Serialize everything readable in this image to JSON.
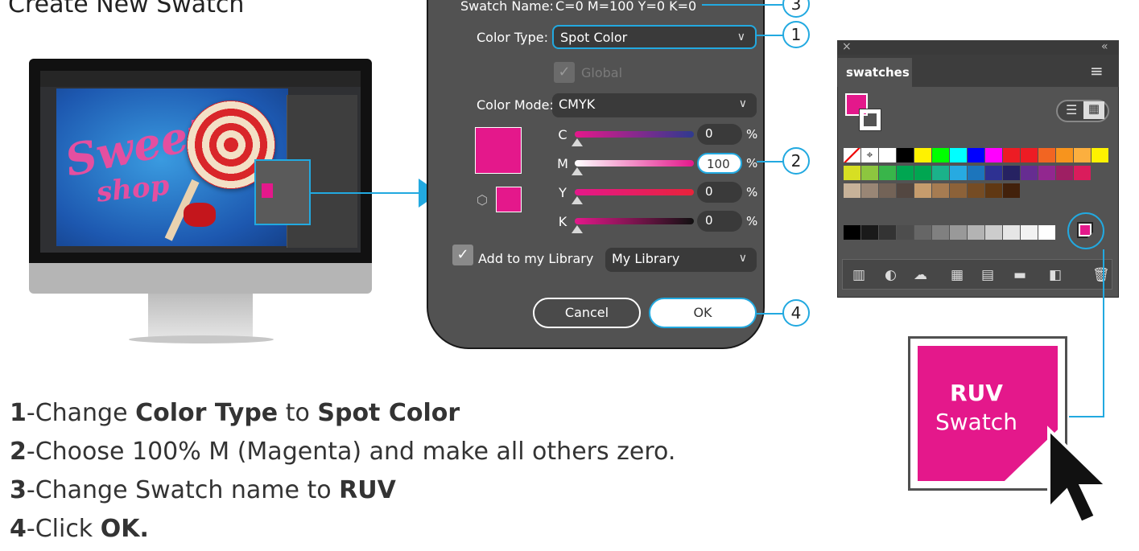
{
  "title": "Create New Swatch",
  "steps": [
    {
      "num": "1",
      "parts": [
        "-Change ",
        "Color Type",
        " to ",
        "Spot Color",
        ""
      ]
    },
    {
      "num": "2",
      "text": "-Choose 100% M (Magenta) and make all others zero."
    },
    {
      "num": "3",
      "text": "-Change Swatch name to ",
      "bold": "RUV"
    },
    {
      "num": "4",
      "text": "-Click ",
      "bold": "OK."
    }
  ],
  "monitor": {
    "art_text_1": "Sweet",
    "art_text_2": "shop"
  },
  "dialog": {
    "swatch_name_label": "Swatch Name:",
    "swatch_name_value": "C=0 M=100 Y=0 K=0",
    "color_type_label": "Color Type:",
    "color_type_value": "Spot Color",
    "global_label": "Global",
    "color_mode_label": "Color Mode:",
    "color_mode_value": "CMYK",
    "sliders": [
      {
        "label": "C",
        "value": "0",
        "unit": "%"
      },
      {
        "label": "M",
        "value": "100",
        "unit": "%"
      },
      {
        "label": "Y",
        "value": "0",
        "unit": "%"
      },
      {
        "label": "K",
        "value": "0",
        "unit": "%"
      }
    ],
    "add_to_library_label": "Add to my Library",
    "library_value": "My Library",
    "cancel_label": "Cancel",
    "ok_label": "OK",
    "swatch_color": "#E4188B"
  },
  "callouts": [
    "3",
    "1",
    "2",
    "4"
  ],
  "swatches_panel": {
    "close_glyph": "×",
    "collapse_glyph": "«",
    "tab_label": "swatches",
    "menu_glyph": "≡"
  },
  "ruv_swatch": {
    "line1": "RUV",
    "line2": "Swatch"
  },
  "colors": {
    "accent": "#22A9E0",
    "magenta": "#E4188B",
    "dialog_bg": "#525252"
  }
}
